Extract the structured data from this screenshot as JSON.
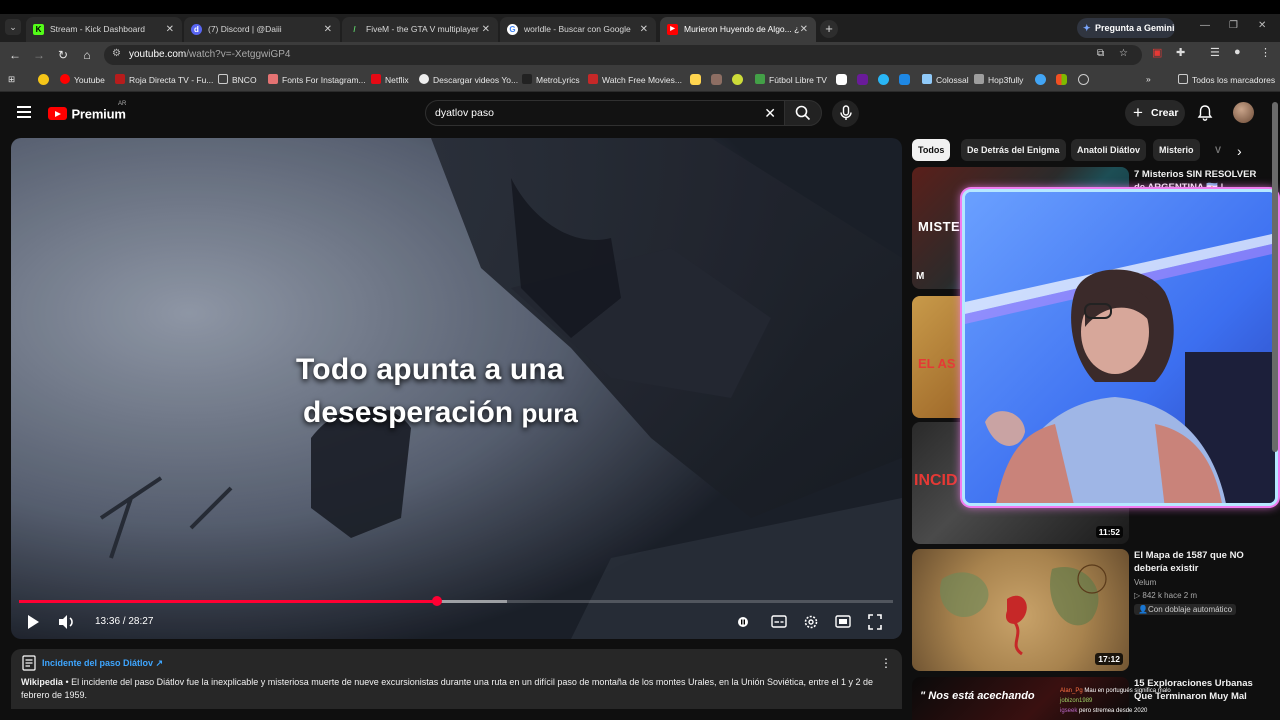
{
  "browser": {
    "tabs": [
      {
        "title": "Stream - Kick Dashboard",
        "fav_color": "#53fc18",
        "fav_text": "K"
      },
      {
        "title": "(7) Discord | @Daiii",
        "fav_color": "#5865f2",
        "fav_text": "d"
      },
      {
        "title": "FiveM - the GTA V multiplayer",
        "fav_color": "#2b2b2b",
        "fav_text": "/"
      },
      {
        "title": "worldle - Buscar con Google",
        "fav_color": "#ffffff",
        "fav_text": "G"
      },
      {
        "title": "Murieron Huyendo de Algo... ¿",
        "fav_color": "#ff0000",
        "fav_text": "▶"
      }
    ],
    "gemini_label": "Pregunta a Gemini",
    "url_host": "youtube.com",
    "url_path": "/watch?v=-XetggwiGP4",
    "bookmarks": [
      "Youtube",
      "Roja Directa TV - Fu...",
      "BNCO",
      "Fonts For Instagram...",
      "Netflix",
      "Descargar videos Yo...",
      "MetroLyrics",
      "Watch Free Movies...",
      "Fútbol Libre TV",
      "Colossal",
      "Hop3fully"
    ],
    "all_bookmarks": "Todos los marcadores"
  },
  "youtube": {
    "logo_text": "Premium",
    "region": "AR",
    "search_query": "dyatlov paso",
    "create_label": "Crear"
  },
  "player": {
    "caption_line1": "Todo apunta a una",
    "caption_line2a": "desesperación",
    "caption_line2b": "pura",
    "current_time": "13:36",
    "total_time": "28:27",
    "time_display": "13:36 / 28:27",
    "played_fraction": 0.4779,
    "loaded_fraction": 0.5583
  },
  "info_panel": {
    "title": "Incidente del paso Diátlov ↗",
    "source": "Wikipedia",
    "text": " • El incidente del paso Diátlov fue la inexplicable y misteriosa muerte de nueve excursionistas durante una ruta en un difícil paso de montaña de los montes Urales, en la Unión Soviética, entre el 1 y 2 de febrero de 1959."
  },
  "chips": [
    "Todos",
    "De Detrás del Enigma",
    "Anatoli Diátlov",
    "Misterio",
    "V"
  ],
  "recommendations": [
    {
      "title": "7 Misterios SIN RESOLVER de ARGENTINA 🇦🇷 |",
      "duration": ""
    },
    {
      "title": "",
      "duration": ""
    },
    {
      "title": "",
      "duration": "11:52"
    },
    {
      "title": "El Mapa de 1587 que NO debería existir",
      "channel": "Velum",
      "stats": "842 k  hace 2 m",
      "badge": "Con doblaje automático",
      "duration": "17:12"
    },
    {
      "title": "15 Exploraciones Urbanas Que Terminaron Muy Mal",
      "duration": ""
    }
  ],
  "thumb_texts": {
    "misterios": "MISTERIOS",
    "asesino": "EL AS",
    "incidente": "INCID"
  },
  "chat_overlay": [
    {
      "user": "Alan_Pg",
      "msg": "Mau en portugués significa malo"
    },
    {
      "user": "jobizon1989",
      "msg": ""
    },
    {
      "user": "igseek",
      "msg": "pero stremea desde 2020"
    }
  ],
  "chat_thumb_text": "Nos está acechando"
}
